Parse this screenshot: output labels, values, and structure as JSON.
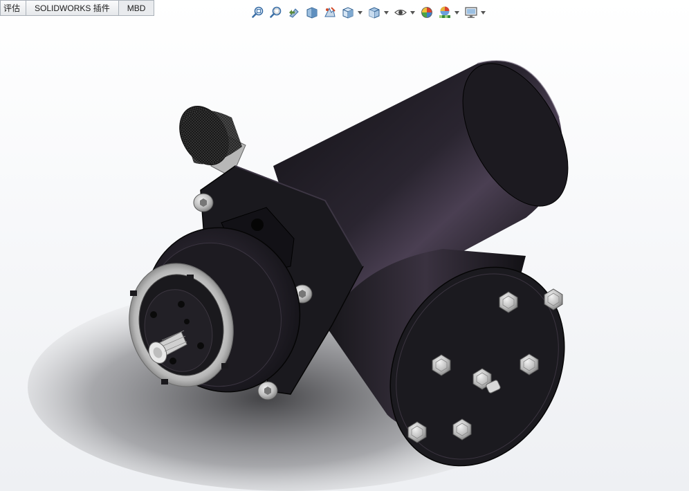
{
  "command_tabs": [
    {
      "label": "评估"
    },
    {
      "label": "SOLIDWORKS 插件"
    },
    {
      "label": "MBD"
    }
  ],
  "view_toolbar": [
    {
      "icon": "zoom-to-fit-icon"
    },
    {
      "icon": "zoom-to-area-icon"
    },
    {
      "icon": "previous-view-icon"
    },
    {
      "icon": "section-view-icon"
    },
    {
      "icon": "dynamic-annotation-views-icon"
    },
    {
      "icon": "view-orientation-icon",
      "has_menu": true
    },
    {
      "icon": "display-style-icon",
      "has_menu": true
    },
    {
      "icon": "hide-show-items-icon",
      "has_menu": true
    },
    {
      "icon": "edit-appearance-icon"
    },
    {
      "icon": "apply-scene-icon",
      "has_menu": true
    },
    {
      "icon": "view-settings-icon",
      "has_menu": true
    }
  ],
  "colors": {
    "body_dark": "#18171b",
    "body_highlight": "#4a3f52",
    "metal": "#c9c9c9",
    "viewport_bg": "#ffffff"
  }
}
